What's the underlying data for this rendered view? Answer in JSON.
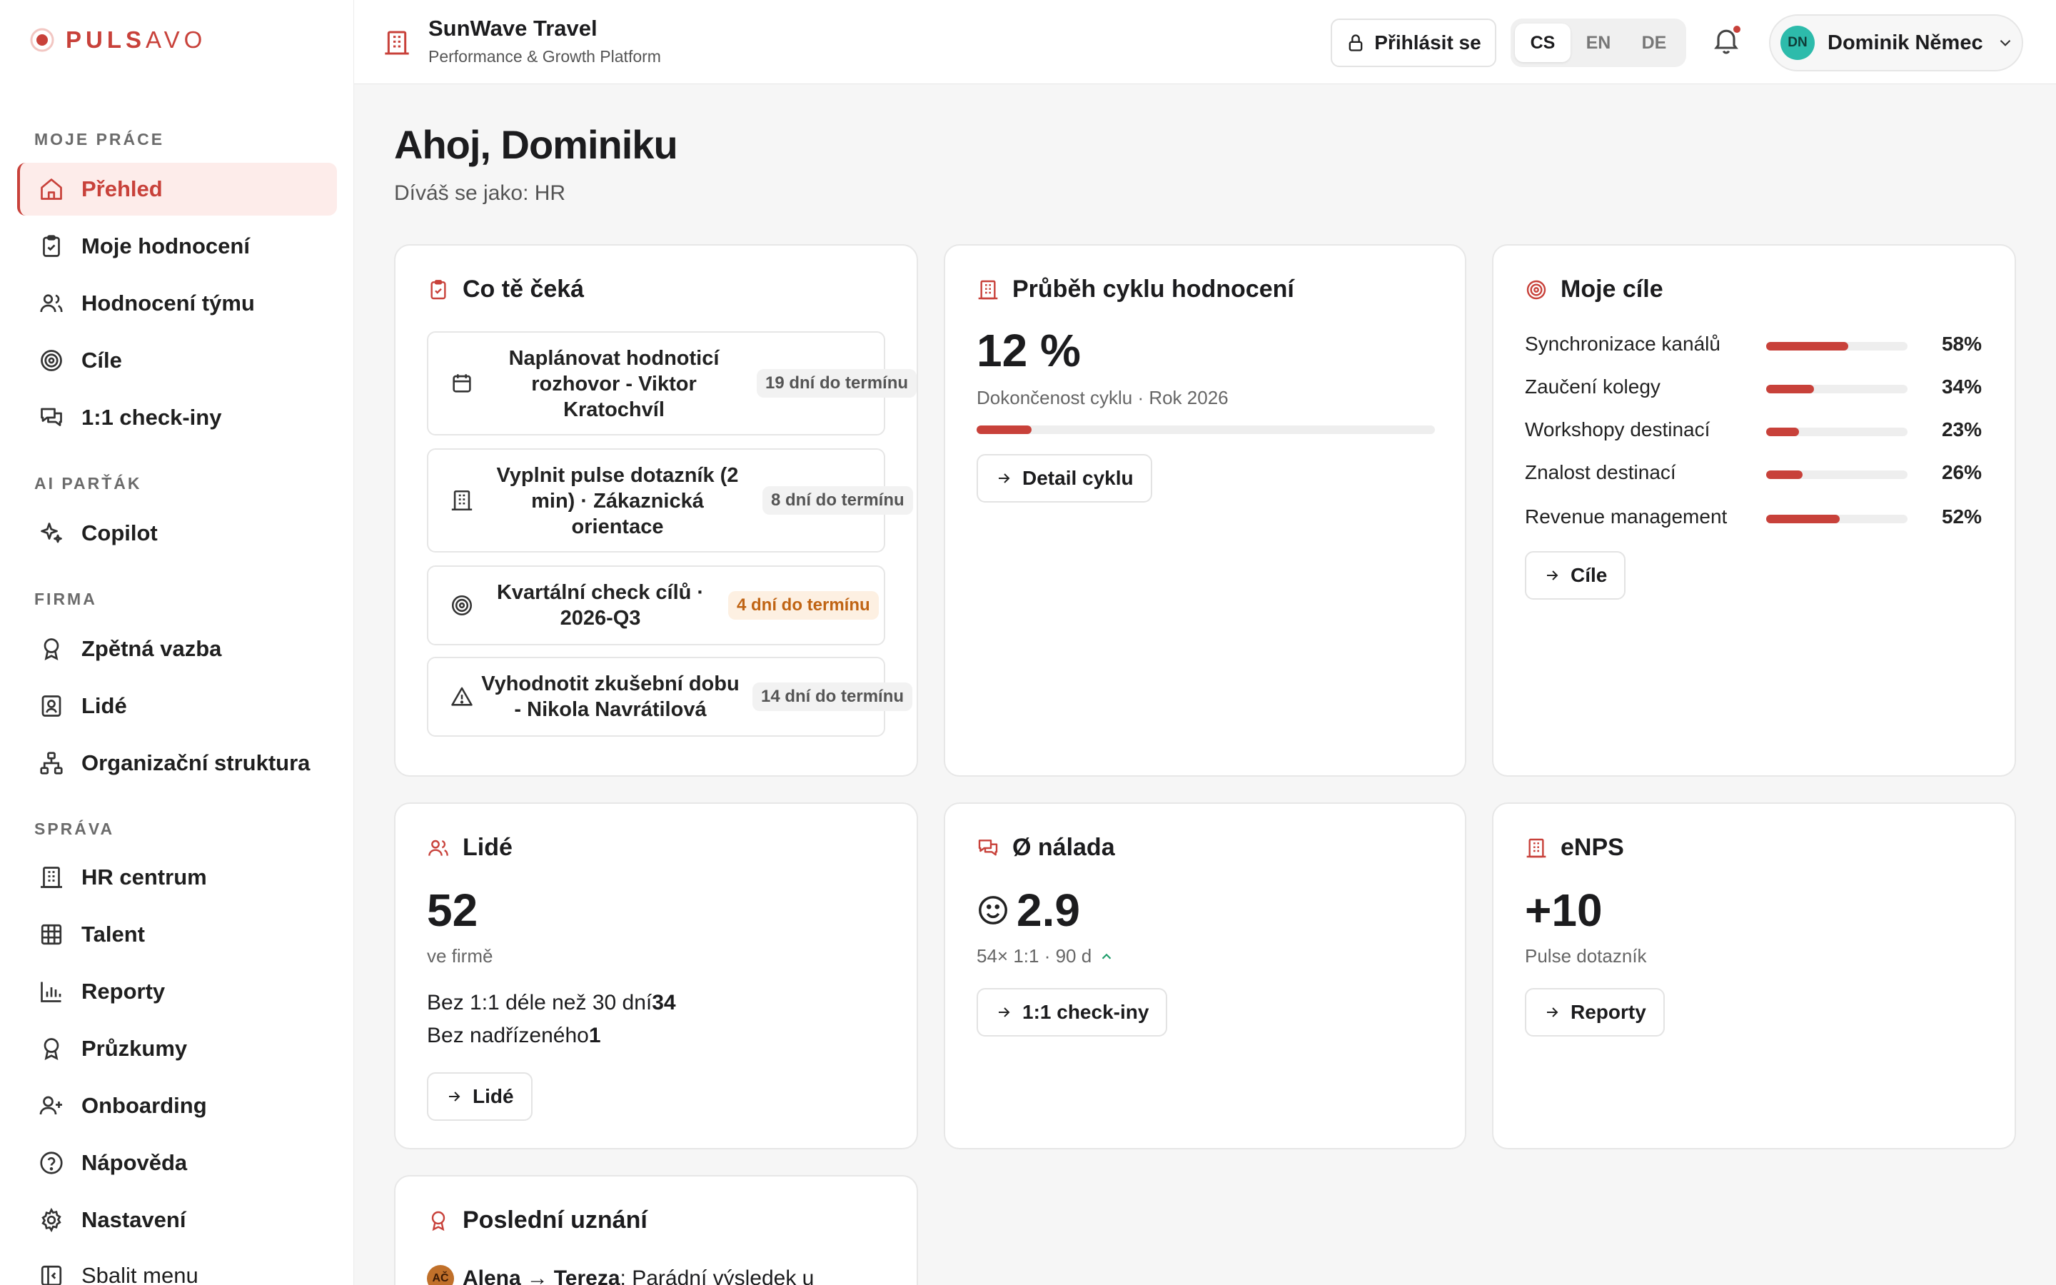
{
  "app": {
    "logo_bold": "PULS",
    "logo_light": "AVO",
    "company": "SunWave Travel",
    "platform": "Performance & Growth Platform",
    "colors": {
      "accent": "#c8413a",
      "avatar": "#2dbbab",
      "warn": "#c06414"
    }
  },
  "sidebar": {
    "sections": [
      {
        "title": "MOJE PRÁCE"
      },
      {
        "title": "AI PARŤÁK"
      },
      {
        "title": "FIRMA"
      },
      {
        "title": "SPRÁVA"
      }
    ],
    "items": [
      {
        "label": "Přehled",
        "icon": "home-icon"
      },
      {
        "label": "Moje hodnocení",
        "icon": "clipboard-icon"
      },
      {
        "label": "Hodnocení týmu",
        "icon": "users-icon"
      },
      {
        "label": "Cíle",
        "icon": "target-icon"
      },
      {
        "label": "1:1 check-iny",
        "icon": "chat-icon"
      },
      {
        "label": "Copilot",
        "icon": "sparkles-icon"
      },
      {
        "label": "Zpětná vazba",
        "icon": "award-icon"
      },
      {
        "label": "Lidé",
        "icon": "id-card-icon"
      },
      {
        "label": "Organizační struktura",
        "icon": "org-chart-icon"
      },
      {
        "label": "HR centrum",
        "icon": "building-icon"
      },
      {
        "label": "Talent",
        "icon": "grid-icon"
      },
      {
        "label": "Reporty",
        "icon": "bar-chart-icon"
      },
      {
        "label": "Průzkumy",
        "icon": "award-icon"
      },
      {
        "label": "Onboarding",
        "icon": "user-plus-icon"
      },
      {
        "label": "Nápověda",
        "icon": "help-icon"
      },
      {
        "label": "Nastavení",
        "icon": "gear-icon"
      },
      {
        "label": "Sbalit menu",
        "icon": "collapse-icon"
      }
    ]
  },
  "header": {
    "login": "Přihlásit se",
    "languages": [
      "CS",
      "EN",
      "DE"
    ],
    "active_language": "CS",
    "user_initials": "DN",
    "user_name": "Dominik Němec"
  },
  "main": {
    "greeting": "Ahoj, Dominiku",
    "viewing_as": "Díváš se jako: HR"
  },
  "todo": {
    "title": "Co tě čeká",
    "items": [
      {
        "text": "Naplánovat hodnoticí rozhovor - Viktor Kratochvíl",
        "due": "19 dní do termínu",
        "icon": "calendar-icon"
      },
      {
        "text": "Vyplnit pulse dotazník (2 min) · Zákaznická orientace",
        "due": "8 dní do termínu",
        "icon": "building-icon"
      },
      {
        "text": "Kvartální check cílů · 2026-Q3",
        "due": "4 dní do termínu",
        "icon": "target-icon"
      },
      {
        "text": "Vyhodnotit zkušební dobu - Nikola Navrátilová",
        "due": "14 dní do termínu",
        "icon": "warning-icon"
      }
    ]
  },
  "cycle": {
    "title": "Průběh cyklu hodnocení",
    "percent_label": "12 %",
    "progress": 0.12,
    "caption": "Dokončenost cyklu · Rok 2026",
    "button": "Detail cyklu"
  },
  "goals": {
    "title": "Moje cíle",
    "items": [
      {
        "name": "Synchronizace kanálů",
        "pct": "58%",
        "value": 0.58
      },
      {
        "name": "Zaučení kolegy",
        "pct": "34%",
        "value": 0.34
      },
      {
        "name": "Workshopy destinací",
        "pct": "23%",
        "value": 0.23
      },
      {
        "name": "Znalost destinací",
        "pct": "26%",
        "value": 0.26
      },
      {
        "name": "Revenue management",
        "pct": "52%",
        "value": 0.52
      }
    ],
    "button": "Cíle"
  },
  "people": {
    "title": "Lidé",
    "count": "52",
    "caption": "ve firmě",
    "no_checkin_label": "Bez 1:1 déle než 30 dní",
    "no_checkin_value": "34",
    "no_manager_label": "Bez nadřízeného",
    "no_manager_value": "1",
    "button": "Lidé"
  },
  "mood": {
    "title": "Ø nálada",
    "value": "2.9",
    "caption": "54× 1:1 · 90 d",
    "button": "1:1 check-iny"
  },
  "enps": {
    "title": "eNPS",
    "value": "+10",
    "caption": "Pulse dotazník",
    "button": "Reporty"
  },
  "recognition": {
    "title": "Poslední uznání",
    "from_initials": "AČ",
    "from": "Alena",
    "arrow": "→",
    "to": "Tereza",
    "text": ": Parádní výsledek u"
  }
}
